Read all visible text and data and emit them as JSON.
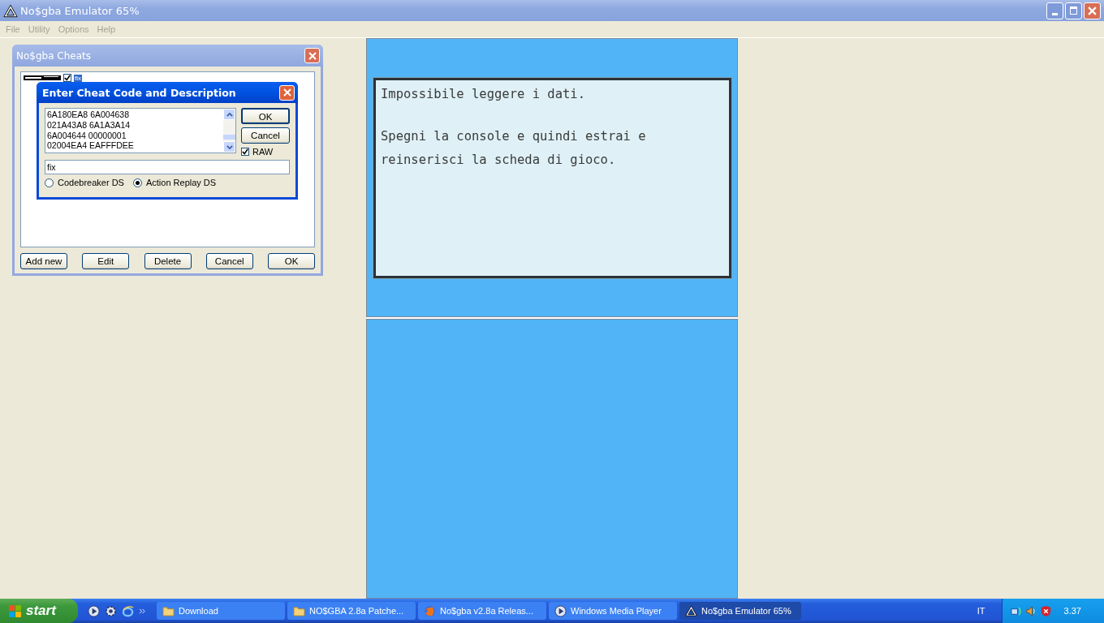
{
  "window": {
    "title": "No$gba Emulator 65%"
  },
  "menu": [
    "File",
    "Utility",
    "Options",
    "Help"
  ],
  "cheats_window": {
    "title": "No$gba Cheats",
    "list": [
      {
        "checked": true,
        "description": "fix",
        "selected": true
      }
    ],
    "buttons": [
      "Add new",
      "Edit",
      "Delete",
      "Cancel",
      "OK"
    ]
  },
  "cheat_dialog": {
    "title": "Enter Cheat Code and Description",
    "code_lines": [
      "6A180EA8 6A004638",
      "021A43A8 6A1A3A14",
      "6A004644 00000001",
      "02004EA4 EAFFFDEE"
    ],
    "description": "fix",
    "raw": {
      "label": "RAW",
      "checked": true
    },
    "formats": [
      {
        "label": "Codebreaker DS",
        "selected": false
      },
      {
        "label": "Action Replay DS",
        "selected": true
      }
    ],
    "buttons": [
      "OK",
      "Cancel"
    ]
  },
  "top_screen": {
    "title": "Impossibile leggere i dati.",
    "message": "Spegni la console e quindi estrai e\nreinserisci la scheda di gioco."
  },
  "taskbar": {
    "start": "start",
    "tasks": [
      {
        "label": "Download",
        "kind": "folder",
        "selected": false
      },
      {
        "label": "NO$GBA 2.8a Patche...",
        "kind": "folder",
        "selected": false
      },
      {
        "label": "No$gba v2.8a Releas...",
        "kind": "browser",
        "selected": false
      },
      {
        "label": "Windows Media Player",
        "kind": "media",
        "selected": false
      },
      {
        "label": "No$gba Emulator 65%",
        "kind": "emulator",
        "selected": true
      }
    ],
    "language": "IT",
    "clock": "3.37"
  }
}
